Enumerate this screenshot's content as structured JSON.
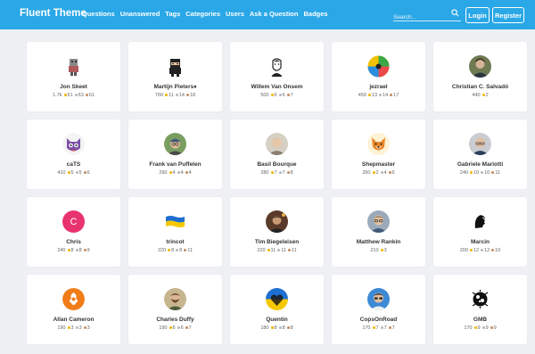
{
  "nav": {
    "brand": "Fluent Theme",
    "menu": [
      "Questions",
      "Unanswered",
      "Tags",
      "Categories",
      "Users",
      "Ask a Question",
      "Badges"
    ],
    "search_placeholder": "Search...",
    "login": "Login",
    "register": "Register"
  },
  "colors": {
    "header": "#2aa7e6",
    "gold": "#f2b400",
    "silver": "#b4b8bc",
    "bronze": "#c38b5f"
  },
  "users": [
    {
      "name": "Jon Skeet",
      "rep": "1.7k",
      "gold": "61",
      "silver": "63",
      "bronze": "61",
      "avatar": "pixel-robot"
    },
    {
      "name": "Martijn Pieters♦",
      "rep": "760",
      "gold": "11",
      "silver": "14",
      "bronze": "18",
      "avatar": "ninja"
    },
    {
      "name": "Willem Van Onsem",
      "rep": "500",
      "gold": "6",
      "silver": "6",
      "bronze": "7",
      "avatar": "sketch-face"
    },
    {
      "name": "jezrael",
      "rep": "450",
      "gold": "13",
      "silver": "14",
      "bronze": "17",
      "avatar": "color-wheel"
    },
    {
      "name": "Christian C. Salvadó",
      "rep": "440",
      "gold": "2",
      "avatar": "photo-man"
    },
    {
      "name": "caTS",
      "rep": "410",
      "gold": "5",
      "silver": "5",
      "bronze": "6",
      "avatar": "cat-cartoon"
    },
    {
      "name": "Frank van Puffelen",
      "rep": "290",
      "gold": "4",
      "silver": "4",
      "bronze": "4",
      "avatar": "photo-cap"
    },
    {
      "name": "Basil Bourque",
      "rep": "280",
      "gold": "7",
      "silver": "7",
      "bronze": "8",
      "avatar": "photo-gray"
    },
    {
      "name": "Shepmaster",
      "rep": "260",
      "gold": "2",
      "silver": "4",
      "bronze": "6",
      "avatar": "fox-cartoon"
    },
    {
      "name": "Gabriele Mariotti",
      "rep": "240",
      "gold": "10",
      "silver": "10",
      "bronze": "11",
      "avatar": "photo-bald"
    },
    {
      "name": "Chris",
      "rep": "240",
      "gold": "8",
      "silver": "8",
      "bronze": "9",
      "avatar": "letter-c",
      "letter": "C"
    },
    {
      "name": "trincot",
      "rep": "220",
      "gold": "8",
      "silver": "8",
      "bronze": "11",
      "avatar": "ukraine-flag"
    },
    {
      "name": "Tim Biegeleisen",
      "rep": "220",
      "gold": "11",
      "silver": "11",
      "bronze": "11",
      "avatar": "photo-dark"
    },
    {
      "name": "Matthew Rankin",
      "rep": "210",
      "gold": "3",
      "avatar": "photo-glasses"
    },
    {
      "name": "Marcin",
      "rep": "200",
      "gold": "12",
      "silver": "12",
      "bronze": "10",
      "avatar": "silhouette"
    },
    {
      "name": "Allan Cameron",
      "rep": "190",
      "gold": "3",
      "silver": "3",
      "bronze": "3",
      "avatar": "orange-emblem"
    },
    {
      "name": "Charles Duffy",
      "rep": "190",
      "gold": "6",
      "silver": "6",
      "bronze": "7",
      "avatar": "photo-beard"
    },
    {
      "name": "Quentin",
      "rep": "180",
      "gold": "8",
      "silver": "8",
      "bronze": "8",
      "avatar": "ukraine-heart"
    },
    {
      "name": "CopsOnRoad",
      "rep": "170",
      "gold": "7",
      "silver": "7",
      "bronze": "7",
      "avatar": "photo-blue"
    },
    {
      "name": "GMB",
      "rep": "170",
      "gold": "9",
      "silver": "9",
      "bronze": "9",
      "avatar": "bw-pattern"
    }
  ]
}
